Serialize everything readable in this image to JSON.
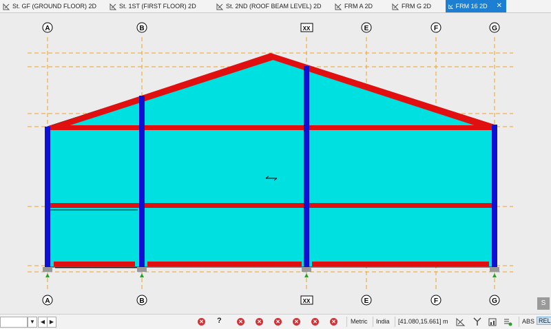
{
  "tabs": [
    {
      "label": "St. GF (GROUND FLOOR) 2D",
      "active": false
    },
    {
      "label": "St. 1ST (FIRST FLOOR) 2D",
      "active": false
    },
    {
      "label": "St. 2ND (ROOF BEAM LEVEL) 2D",
      "active": false
    },
    {
      "label": "FRM A 2D",
      "active": false
    },
    {
      "label": "FRM G 2D",
      "active": false
    },
    {
      "label": "FRM 16 2D",
      "active": true
    }
  ],
  "close_glyph": "✕",
  "axes": [
    "A",
    "B",
    "XX",
    "E",
    "F",
    "G"
  ],
  "colors": {
    "slab": "#00e0e0",
    "beam": "#e01010",
    "column": "#1010d0",
    "grid": "#f0a020",
    "support": "#2aa02a",
    "tab_active": "#1c7fd1"
  },
  "status": {
    "help": "?",
    "units": "Metric",
    "code": "India",
    "coords": "[41.080,15.661] m",
    "abs": "ABS",
    "rel": "REL",
    "nav_prev": "◀",
    "nav_next": "▶",
    "dropdown": "▼",
    "err_glyph": "✕"
  },
  "side_button": "S",
  "icons": [
    "tab-drawing-icon",
    "close-icon",
    "help-icon",
    "error-icon",
    "snap-icon",
    "fork-icon",
    "chart-icon",
    "list-icon"
  ]
}
